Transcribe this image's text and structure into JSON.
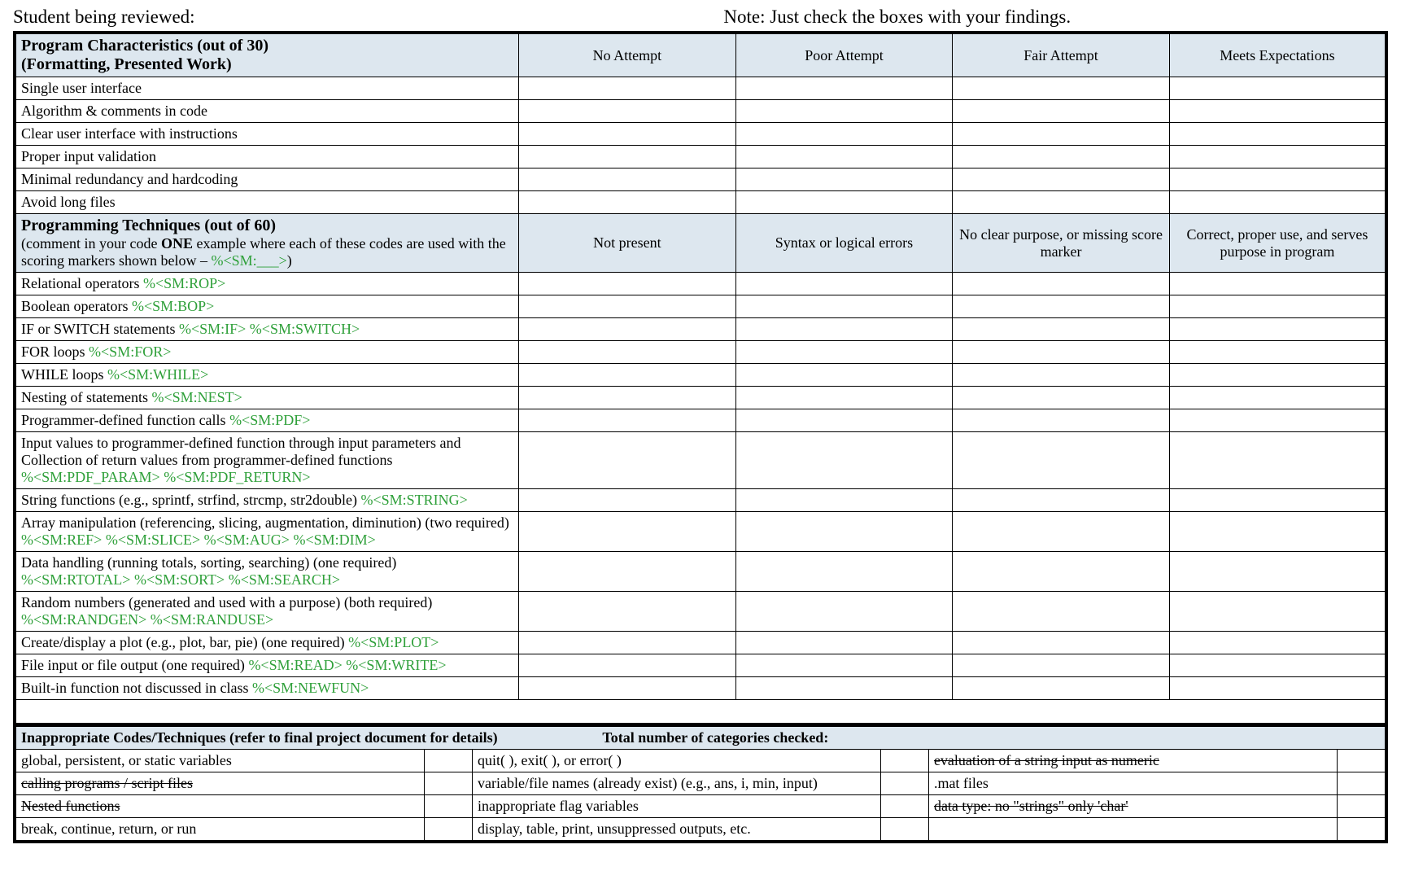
{
  "top": {
    "left": "Student being reviewed:",
    "right": "Note: Just check the boxes with your findings."
  },
  "section1": {
    "title_l1": "Program Characteristics (out of 30)",
    "title_l2": "(Formatting, Presented Work)",
    "cols": [
      "No Attempt",
      "Poor Attempt",
      "Fair Attempt",
      "Meets Expectations"
    ],
    "rows": [
      "Single user interface",
      "Algorithm & comments in code",
      "Clear user interface with instructions",
      "Proper input validation",
      "Minimal redundancy and hardcoding",
      "Avoid long files"
    ]
  },
  "section2": {
    "title": "Programming Techniques (out of 60)",
    "sub1": "(comment in your code ",
    "sub_one": "ONE",
    "sub2": " example where each of these codes are used with the scoring markers shown below – ",
    "sub_marker": "%<SM:___>",
    "sub3": ")",
    "cols": [
      "Not present",
      "Syntax or logical errors",
      "No clear purpose, or missing score marker",
      "Correct, proper use, and serves purpose in program"
    ],
    "rows": [
      {
        "text": "Relational operators   ",
        "marker": "%<SM:ROP>"
      },
      {
        "text": "Boolean operators   ",
        "marker": "%<SM:BOP>"
      },
      {
        "text": "IF or SWITCH statements ",
        "marker": "%<SM:IF>   %<SM:SWITCH>"
      },
      {
        "text": "FOR loops   ",
        "marker": "%<SM:FOR>"
      },
      {
        "text": "WHILE loops   ",
        "marker": "%<SM:WHILE>"
      },
      {
        "text": "Nesting of statements   ",
        "marker": "%<SM:NEST>"
      },
      {
        "text": "Programmer-defined function calls ",
        "marker": "%<SM:PDF>"
      },
      {
        "text": "Input values to programmer-defined function through input parameters and Collection of return values from programmer-defined functions",
        "marker_newline": true,
        "marker": "%<SM:PDF_PARAM>    %<SM:PDF_RETURN>"
      },
      {
        "text": "String functions (e.g., sprintf, strfind, strcmp, str2double) ",
        "marker": "%<SM:STRING>"
      },
      {
        "text": "Array manipulation (referencing, slicing, augmentation, diminution) (two required) ",
        "marker": "%<SM:REF>   %<SM:SLICE>   %<SM:AUG>   %<SM:DIM>"
      },
      {
        "text": "Data handling (running totals, sorting, searching) (one required)",
        "marker_newline": true,
        "marker": "%<SM:RTOTAL>   %<SM:SORT>   %<SM:SEARCH>"
      },
      {
        "text": "Random numbers (generated and used with a purpose) (both required)",
        "marker_newline": true,
        "marker": "%<SM:RANDGEN>   %<SM:RANDUSE>"
      },
      {
        "text": "Create/display a plot (e.g., plot, bar, pie) (one required)    ",
        "marker": "%<SM:PLOT>"
      },
      {
        "text": "File input or file output (one required)   ",
        "marker": "%<SM:READ>    %<SM:WRITE>"
      },
      {
        "text": "Built-in function not discussed in class    ",
        "marker": "%<SM:NEWFUN>"
      }
    ]
  },
  "section3": {
    "head_l": "Inappropriate Codes/Techniques (refer to final project document for details)",
    "head_r": "Total number of categories checked:",
    "rows": [
      [
        {
          "t": "global, persistent, or static variables",
          "s": false
        },
        {
          "t": "quit( ), exit( ), or error( )",
          "s": false
        },
        {
          "t": "evaluation of a string input as numeric",
          "s": true
        }
      ],
      [
        {
          "t": "calling programs / script files",
          "s": true
        },
        {
          "t": "variable/file names (already exist) (e.g., ans, i, min, input)",
          "s": false
        },
        {
          "t": ".mat files",
          "s": false
        }
      ],
      [
        {
          "t": "Nested functions",
          "s": true
        },
        {
          "t": "inappropriate flag variables",
          "s": false
        },
        {
          "t": "data type: no \"strings\" only 'char'",
          "s": true
        }
      ],
      [
        {
          "t": "break, continue, return, or run",
          "s": false
        },
        {
          "t": "display, table, print, unsuppressed outputs, etc.",
          "s": false
        },
        {
          "t": "",
          "s": false
        }
      ]
    ]
  }
}
